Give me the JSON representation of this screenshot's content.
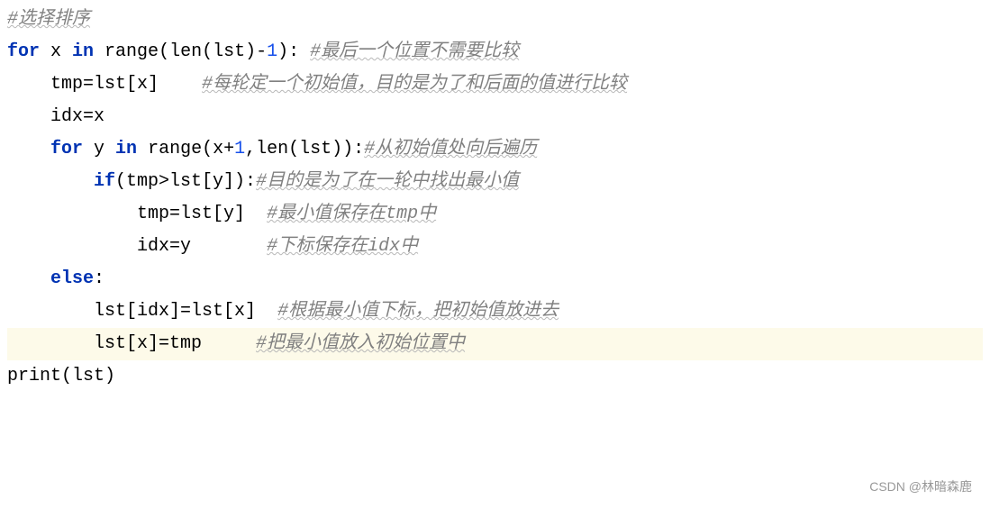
{
  "lines": [
    {
      "indent": 0,
      "segments": [
        {
          "type": "comment",
          "text": "#选择排序",
          "wave": true
        }
      ]
    },
    {
      "indent": 0,
      "segments": [
        {
          "type": "keyword",
          "text": "for "
        },
        {
          "type": "identifier",
          "text": "x "
        },
        {
          "type": "keyword",
          "text": "in "
        },
        {
          "type": "func",
          "text": "range"
        },
        {
          "type": "punct",
          "text": "("
        },
        {
          "type": "func",
          "text": "len"
        },
        {
          "type": "punct",
          "text": "(lst)-"
        },
        {
          "type": "number",
          "text": "1"
        },
        {
          "type": "punct",
          "text": "): "
        },
        {
          "type": "comment",
          "text": "#最后一个位置不需要比较",
          "wave": true
        }
      ]
    },
    {
      "indent": 1,
      "segments": [
        {
          "type": "identifier",
          "text": "tmp=lst[x]    "
        },
        {
          "type": "comment",
          "text": "#每轮定一个初始值，目的是为了和后面的值进行比较",
          "wave": true
        }
      ]
    },
    {
      "indent": 1,
      "segments": [
        {
          "type": "identifier",
          "text": "idx=x"
        }
      ]
    },
    {
      "indent": 1,
      "segments": [
        {
          "type": "keyword",
          "text": "for "
        },
        {
          "type": "identifier",
          "text": "y "
        },
        {
          "type": "keyword",
          "text": "in "
        },
        {
          "type": "func",
          "text": "range"
        },
        {
          "type": "punct",
          "text": "(x+"
        },
        {
          "type": "number",
          "text": "1"
        },
        {
          "type": "punct",
          "text": ","
        },
        {
          "type": "func",
          "text": "len"
        },
        {
          "type": "punct",
          "text": "(lst)):"
        },
        {
          "type": "comment",
          "text": "#从初始值处向后遍历",
          "wave": true
        }
      ]
    },
    {
      "indent": 2,
      "segments": [
        {
          "type": "keyword",
          "text": "if"
        },
        {
          "type": "punct",
          "text": "(tmp>lst[y]):"
        },
        {
          "type": "comment",
          "text": "#目的是为了在一轮中找出最小值",
          "wave": true
        }
      ]
    },
    {
      "indent": 3,
      "segments": [
        {
          "type": "identifier",
          "text": "tmp=lst[y]  "
        },
        {
          "type": "comment",
          "text": "#最小值保存在tmp中",
          "wave": true
        }
      ]
    },
    {
      "indent": 3,
      "segments": [
        {
          "type": "identifier",
          "text": "idx=y       "
        },
        {
          "type": "comment",
          "text": "#下标保存在idx中",
          "wave": true
        }
      ]
    },
    {
      "indent": 1,
      "segments": [
        {
          "type": "keyword",
          "text": "else"
        },
        {
          "type": "punct",
          "text": ":"
        }
      ]
    },
    {
      "indent": 2,
      "segments": [
        {
          "type": "identifier",
          "text": "lst[idx]=lst[x]  "
        },
        {
          "type": "comment",
          "text": "#根据最小值下标，把初始值放进去",
          "wave": true
        }
      ]
    },
    {
      "indent": 2,
      "highlighted": true,
      "segments": [
        {
          "type": "identifier",
          "text": "lst[x]=tmp     "
        },
        {
          "type": "comment",
          "text": "#把最小值放入初始位置中",
          "wave": true
        }
      ]
    },
    {
      "indent": 0,
      "segments": [
        {
          "type": "func",
          "text": "print"
        },
        {
          "type": "punct",
          "text": "(lst)"
        }
      ]
    }
  ],
  "watermark": "CSDN @林暗森鹿"
}
